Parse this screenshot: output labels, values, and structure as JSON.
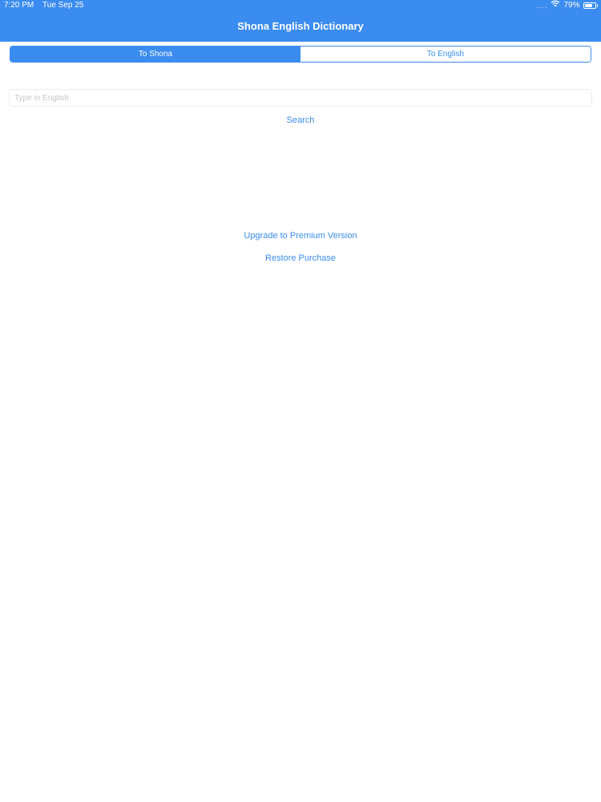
{
  "status_bar": {
    "time": "7:20 PM",
    "date": "Tue Sep 25",
    "signal_dots": "....",
    "wifi_icon": "wifi-icon",
    "battery_percent": "79%",
    "battery_level": 0.79
  },
  "nav": {
    "title": "Shona English Dictionary"
  },
  "segmented_control": {
    "selected_index": 0,
    "segments": [
      {
        "label": "To Shona"
      },
      {
        "label": "To English"
      }
    ]
  },
  "search": {
    "value": "",
    "placeholder": "Type in English",
    "button_label": "Search"
  },
  "actions": {
    "upgrade_label": "Upgrade to Premium Version",
    "restore_label": "Restore Purchase"
  },
  "colors": {
    "accent": "#3b8cf0",
    "background": "#ffffff",
    "placeholder": "#c7c7cc"
  }
}
